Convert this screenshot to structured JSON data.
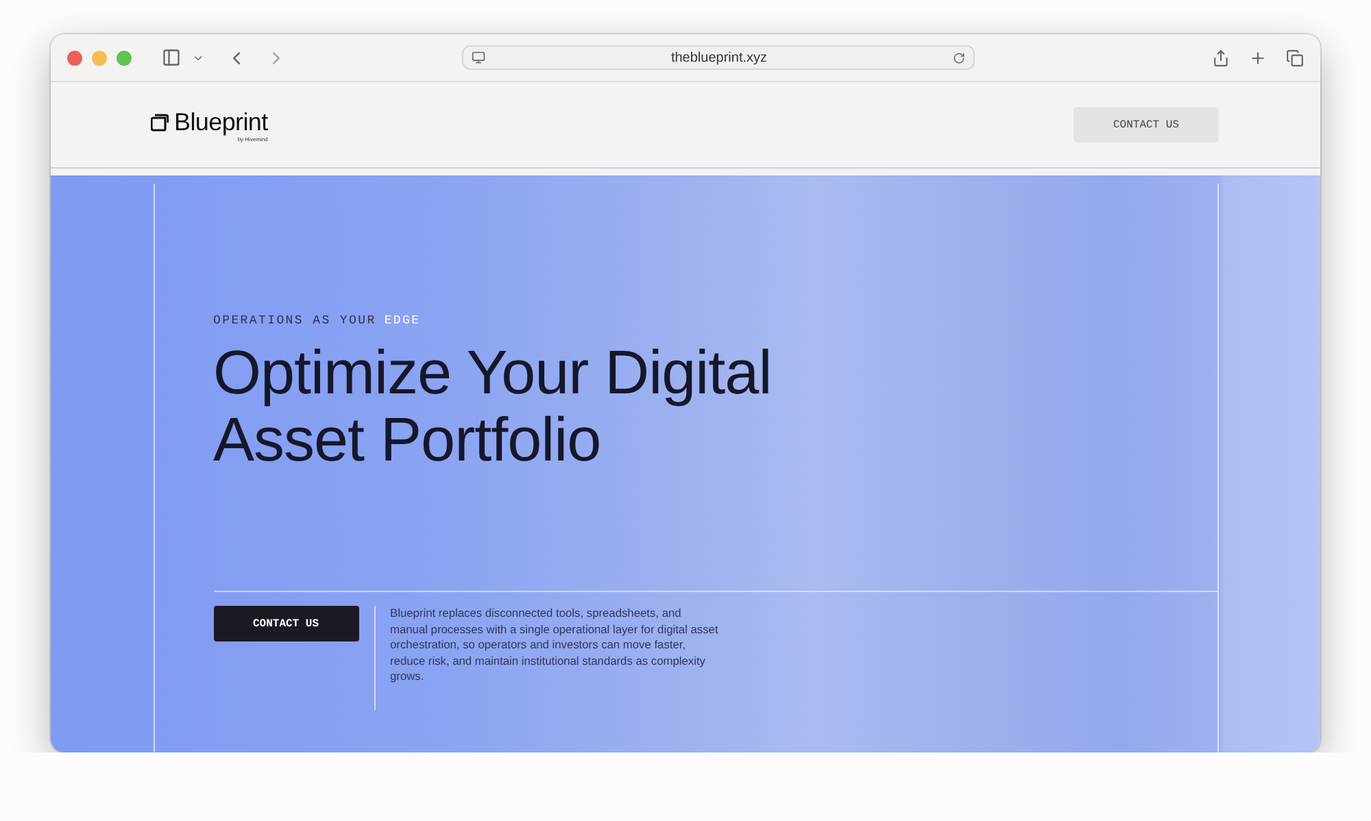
{
  "browser": {
    "url": "theblueprint.xyz"
  },
  "header": {
    "logo": "Blueprint",
    "logo_sub": "by Hivemind",
    "button": "CONTACT US"
  },
  "hero": {
    "eyebrow": "OPERATIONS AS YOUR",
    "eyebrow_accent": "EDGE",
    "headline": [
      "Optimize Your Digital",
      "Asset Portfolio"
    ],
    "button": "CONTACT US",
    "description": "Blueprint replaces disconnected tools, spreadsheets, and manual processes with a single operational layer for digital asset orchestration, so operators and investors can move faster, reduce risk, and maintain institutional standards as complexity grows."
  }
}
